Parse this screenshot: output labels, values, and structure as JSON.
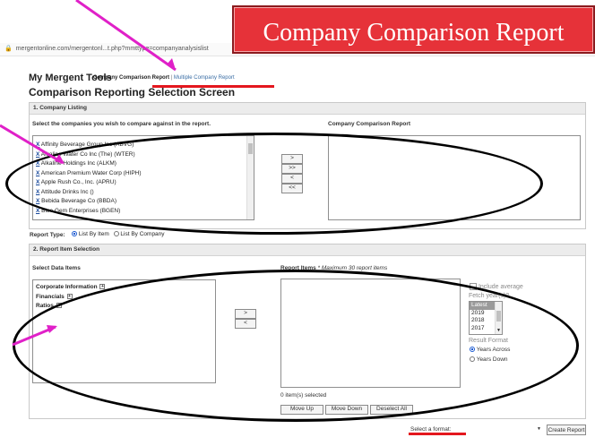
{
  "banner": {
    "title": "Company Comparison Report"
  },
  "browser": {
    "url": "mergentonline.com/mergentonl...t.php?mmttype=companyanalysislist"
  },
  "header": {
    "tools_title": "My Mergent Tools",
    "active_link": "Company Comparison Report",
    "separator": "|",
    "other_link": "Multiple Company Report",
    "screen_title": "Comparison Reporting Selection Screen"
  },
  "company_listing": {
    "heading": "1. Company Listing",
    "select_label": "Select the companies you wish to compare against in the report.",
    "report_label": "Company Comparison Report",
    "companies": [
      "Affinity Beverage Group Inc (ABVG)",
      "Alkaline Water Co Inc (The) (WTER)",
      "Alkaline Holdings Inc (ALKM)",
      "American Premium Water Corp (HIPH)",
      "Apple Rush Co., Inc. (APRU)",
      "Attitude Drinks Inc ()",
      "Bebida Beverage Co (BBDA)",
      "Blue Gem Enterprises (BGEN)"
    ],
    "move_buttons": [
      ">",
      ">>",
      "<",
      "<<"
    ]
  },
  "report_type": {
    "label": "Report Type:",
    "option_by_item": "List By Item",
    "option_by_company": "List By Company",
    "selected": "List By Item"
  },
  "report_item_selection": {
    "heading": "2. Report Item Selection",
    "select_label": "Select Data Items",
    "report_label": "Report Items",
    "report_note": "* Maximum 30 report items",
    "data_items": [
      "Corporate Information",
      "Financials",
      "Ratios"
    ],
    "buttons": [
      ">",
      "<"
    ],
    "include_average": "Include average",
    "fetch_years_label": "Fetch year(s)?",
    "years": [
      "Latest",
      "2019",
      "2018",
      "2017"
    ],
    "result_format_label": "Result Format",
    "format_across": "Years Across",
    "format_down": "Years Down",
    "format_selected": "Years Across",
    "selected_count": "0 item(s) selected",
    "move_up": "Move Up",
    "move_down": "Move Down",
    "deselect_all": "Deselect All"
  },
  "footer": {
    "format_placeholder": "Select a format:",
    "create_report": "Create Report"
  },
  "colors": {
    "banner": "#e63239",
    "annotation_red": "#e4171e",
    "annotation_magenta": "#e020c8"
  }
}
